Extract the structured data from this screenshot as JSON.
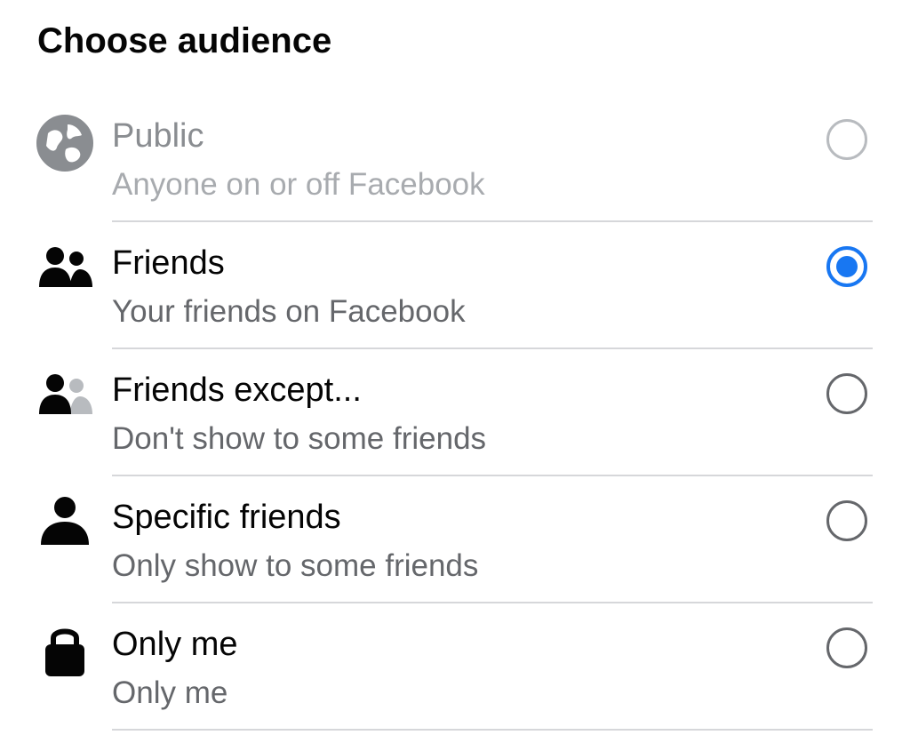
{
  "header": {
    "title": "Choose audience"
  },
  "options": [
    {
      "label": "Public",
      "description": "Anyone on or off Facebook",
      "icon": "globe-icon",
      "selected": false,
      "disabled": true
    },
    {
      "label": "Friends",
      "description": "Your friends on Facebook",
      "icon": "friends-icon",
      "selected": true,
      "disabled": false
    },
    {
      "label": "Friends except...",
      "description": "Don't show to some friends",
      "icon": "friends-except-icon",
      "selected": false,
      "disabled": false
    },
    {
      "label": "Specific friends",
      "description": "Only show to some friends",
      "icon": "person-icon",
      "selected": false,
      "disabled": false
    },
    {
      "label": "Only me",
      "description": "Only me",
      "icon": "lock-icon",
      "selected": false,
      "disabled": false
    }
  ],
  "colors": {
    "accent": "#1877f2",
    "primary_text": "#050505",
    "secondary_text": "#65676b",
    "disabled_text": "#8a8d91",
    "divider": "#d6d7da"
  }
}
